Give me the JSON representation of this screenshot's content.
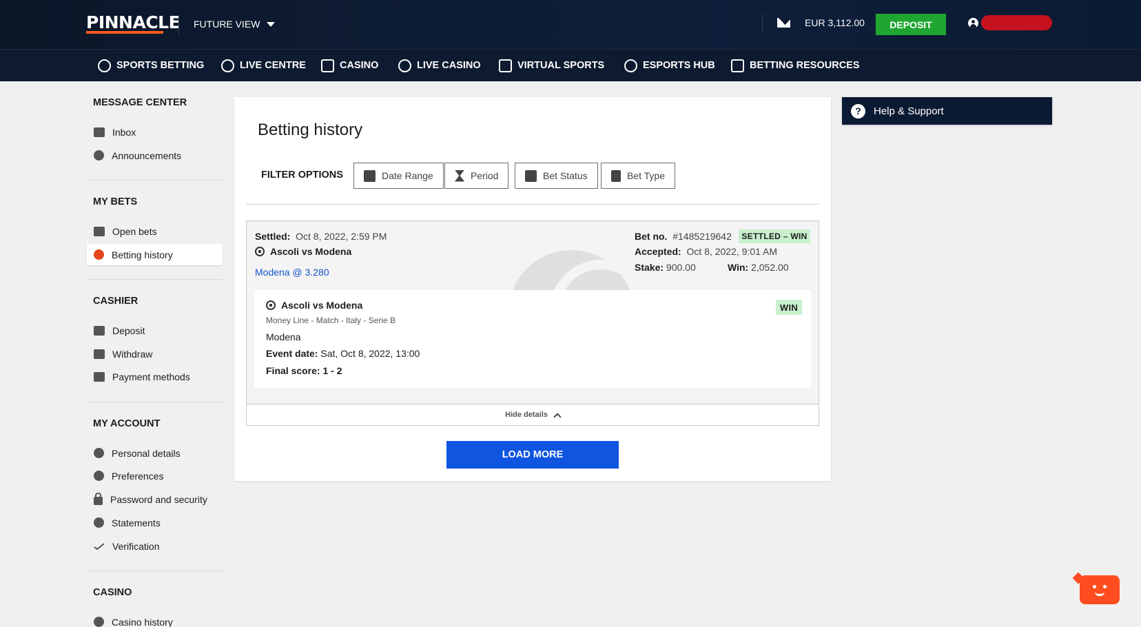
{
  "header": {
    "logo_text": "PINNACLE",
    "view_label": "FUTURE VIEW",
    "balance": "EUR 3,112.00",
    "deposit_label": "DEPOSIT"
  },
  "nav": {
    "items": [
      {
        "label": "SPORTS BETTING",
        "icon": "soccer-ball-icon"
      },
      {
        "label": "LIVE CENTRE",
        "icon": "stopwatch-icon"
      },
      {
        "label": "CASINO",
        "icon": "dice-icon"
      },
      {
        "label": "LIVE CASINO",
        "icon": "roulette-icon"
      },
      {
        "label": "VIRTUAL SPORTS",
        "icon": "horse-icon"
      },
      {
        "label": "ESPORTS HUB",
        "icon": "headset-icon"
      },
      {
        "label": "BETTING RESOURCES",
        "icon": "book-icon"
      }
    ]
  },
  "sidebar": {
    "message_center": {
      "title": "MESSAGE CENTER",
      "items": [
        "Inbox",
        "Announcements"
      ]
    },
    "my_bets": {
      "title": "MY BETS",
      "items": [
        "Open bets",
        "Betting history"
      ]
    },
    "cashier": {
      "title": "CASHIER",
      "items": [
        "Deposit",
        "Withdraw",
        "Payment methods"
      ]
    },
    "my_account": {
      "title": "MY ACCOUNT",
      "items": [
        "Personal details",
        "Preferences",
        "Password and security",
        "Statements",
        "Verification"
      ]
    },
    "casino": {
      "title": "CASINO",
      "items": [
        "Casino history"
      ]
    }
  },
  "main": {
    "title": "Betting history",
    "filter_label": "FILTER OPTIONS",
    "filters": [
      "Date Range",
      "Period",
      "Bet Status",
      "Bet Type"
    ],
    "bet": {
      "settled_label": "Settled:",
      "settled_value": "Oct 8, 2022, 2:59 PM",
      "match": "Ascoli vs Modena",
      "selection": "Modena",
      "odds": "@ 3.280",
      "bet_no_label": "Bet no.",
      "bet_no_value": "#1485219642",
      "status_badge": "SETTLED – WIN",
      "accepted_label": "Accepted:",
      "accepted_value": "Oct 8, 2022, 9:01 AM",
      "stake_label": "Stake:",
      "stake_value": "900.00",
      "win_label": "Win:",
      "win_value": "2,052.00",
      "detail": {
        "match": "Ascoli vs Modena",
        "market": "Money Line - Match - Italy - Serie B",
        "selection": "Modena",
        "event_date_label": "Event date:",
        "event_date_value": "Sat, Oct 8, 2022, 13:00",
        "final_score_label": "Final score:",
        "final_score_value": "1 - 2",
        "result_badge": "WIN"
      },
      "hide_details_label": "Hide details"
    },
    "load_more_label": "LOAD MORE"
  },
  "help": {
    "label": "Help & Support"
  },
  "colors": {
    "accent": "#ff5a1f",
    "deposit": "#1fa631",
    "link": "#1155cc",
    "load_more": "#1055e0",
    "badge_bg": "#c9efcd",
    "header_bg": "#0b1628"
  }
}
